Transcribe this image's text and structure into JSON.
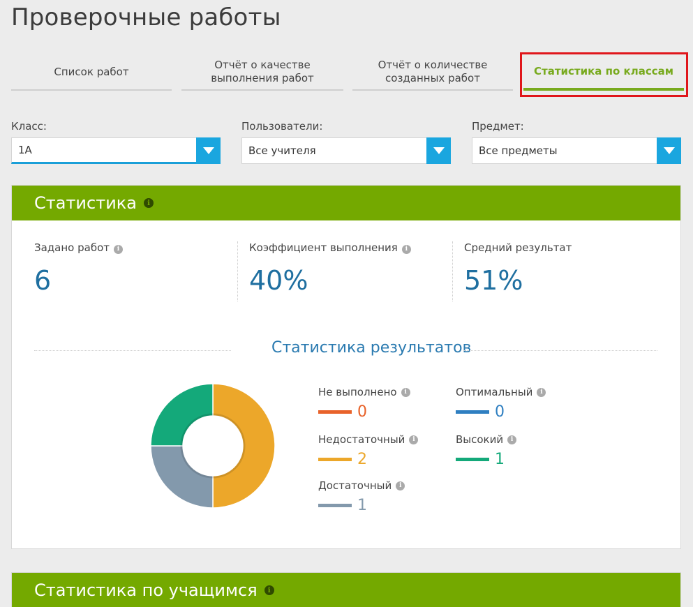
{
  "page": {
    "title": "Проверочные работы"
  },
  "tabs": [
    {
      "label": "Список работ",
      "active": false
    },
    {
      "label": "Отчёт о качестве выполнения работ",
      "active": false
    },
    {
      "label": "Отчёт о количестве созданных работ",
      "active": false
    },
    {
      "label": "Статистика по классам",
      "active": true
    }
  ],
  "filters": {
    "class": {
      "label": "Класс:",
      "value": "1А"
    },
    "users": {
      "label": "Пользователи:",
      "value": "Все учителя"
    },
    "subject": {
      "label": "Предмет:",
      "value": "Все предметы"
    }
  },
  "stats_panel": {
    "title": "Статистика",
    "assigned": {
      "label": "Задано работ",
      "value": "6"
    },
    "completion": {
      "label": "Коэффициент выполнения",
      "value": "40%"
    },
    "average": {
      "label": "Средний результат",
      "value": "51%"
    },
    "results_title": "Статистика результатов",
    "legend": [
      {
        "label": "Не выполнено",
        "count": "0",
        "color": "#e8622a"
      },
      {
        "label": "Оптимальный",
        "count": "0",
        "color": "#2f7fc1"
      },
      {
        "label": "Недостаточный",
        "count": "2",
        "color": "#eca72a"
      },
      {
        "label": "Высокий",
        "count": "1",
        "color": "#14a97a"
      },
      {
        "label": "Достаточный",
        "count": "1",
        "color": "#8399ac"
      }
    ],
    "donut_colors": {
      "insufficient": "#eca72a",
      "sufficient": "#8399ac",
      "high": "#14a97a"
    }
  },
  "students_panel": {
    "title": "Статистика по учащимся"
  },
  "colors": {
    "accent_green": "#74a900",
    "accent_blue": "#1aa6df",
    "highlight_red": "#e0161b"
  }
}
